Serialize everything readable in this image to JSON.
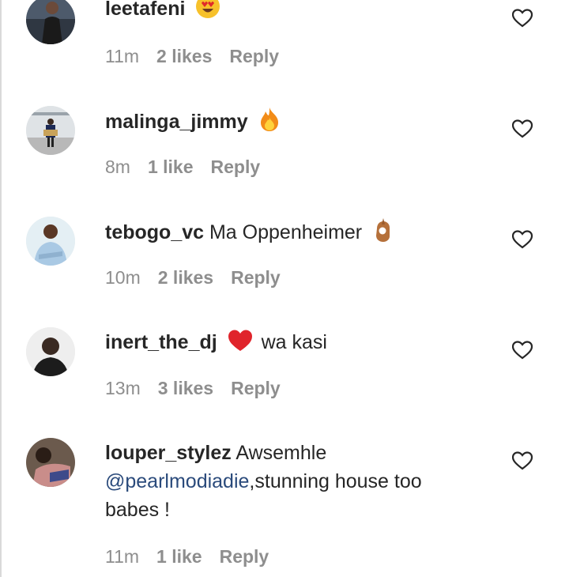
{
  "comments": [
    {
      "username": "leetafeni",
      "text": "",
      "emoji": "heart-eyes-emoji",
      "time": "11m",
      "likes": "2 likes",
      "reply": "Reply"
    },
    {
      "username": "malinga_jimmy",
      "text": "",
      "emoji": "fire-emoji",
      "time": "8m",
      "likes": "1 like",
      "reply": "Reply"
    },
    {
      "username": "tebogo_vc",
      "text": "Ma Oppenheimer",
      "emoji": "ok-hand-emoji",
      "time": "10m",
      "likes": "2 likes",
      "reply": "Reply"
    },
    {
      "username": "inert_the_dj",
      "text": "wa kasi",
      "emoji": "red-heart-emoji",
      "time": "13m",
      "likes": "3 likes",
      "reply": "Reply"
    },
    {
      "username": "louper_stylez",
      "text_before": "Awsemhle",
      "mention": "@pearlmodiadie",
      "text_after": ",stunning house too babes !",
      "time": "11m",
      "likes": "1 like",
      "reply": "Reply"
    }
  ],
  "colors": {
    "text": "#262626",
    "meta": "#8e8e8e",
    "mention": "#2a4a7b",
    "background": "#ffffff"
  }
}
